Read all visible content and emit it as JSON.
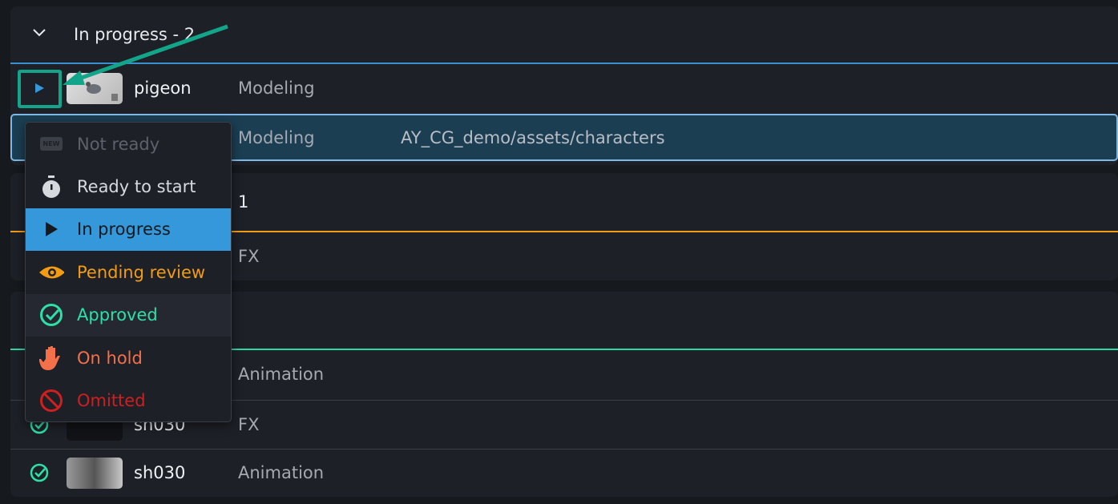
{
  "groups": [
    {
      "header": "In progress - 2",
      "line_color": "#3a8fd0",
      "rows": [
        {
          "status_icon": "play-icon",
          "name": "pigeon",
          "task": "Modeling"
        },
        {
          "task": "Modeling",
          "path": "AY_CG_demo/assets/characters",
          "selected": true
        }
      ]
    },
    {
      "header": "1",
      "line_color": "#f29b1a",
      "rows": [
        {
          "task": "FX"
        }
      ]
    },
    {
      "header": "",
      "line_color": "#2bd9a5",
      "rows": [
        {
          "task": "Animation"
        },
        {
          "status_icon": "check-circle-icon",
          "name": "sh030",
          "task": "FX"
        },
        {
          "status_icon": "check-circle-icon",
          "name": "sh030",
          "task": "Animation"
        }
      ]
    }
  ],
  "status_menu": [
    {
      "label": "Not ready",
      "icon": "new-badge-icon",
      "color": "#5c616b",
      "badge": "NEW"
    },
    {
      "label": "Ready to start",
      "icon": "stopwatch-icon",
      "color": "#d6d9de"
    },
    {
      "label": "In progress",
      "icon": "play-icon",
      "color": "#16191d",
      "selected": true,
      "bg": "#3498db"
    },
    {
      "label": "Pending review",
      "icon": "eye-icon",
      "color": "#f39c12"
    },
    {
      "label": "Approved",
      "icon": "check-circle-icon",
      "color": "#2de0a7",
      "hovered": true
    },
    {
      "label": "On hold",
      "icon": "hand-icon",
      "color": "#f3704a"
    },
    {
      "label": "Omitted",
      "icon": "ban-icon",
      "color": "#cf1f1f"
    }
  ],
  "annotation_color": "#13a589"
}
